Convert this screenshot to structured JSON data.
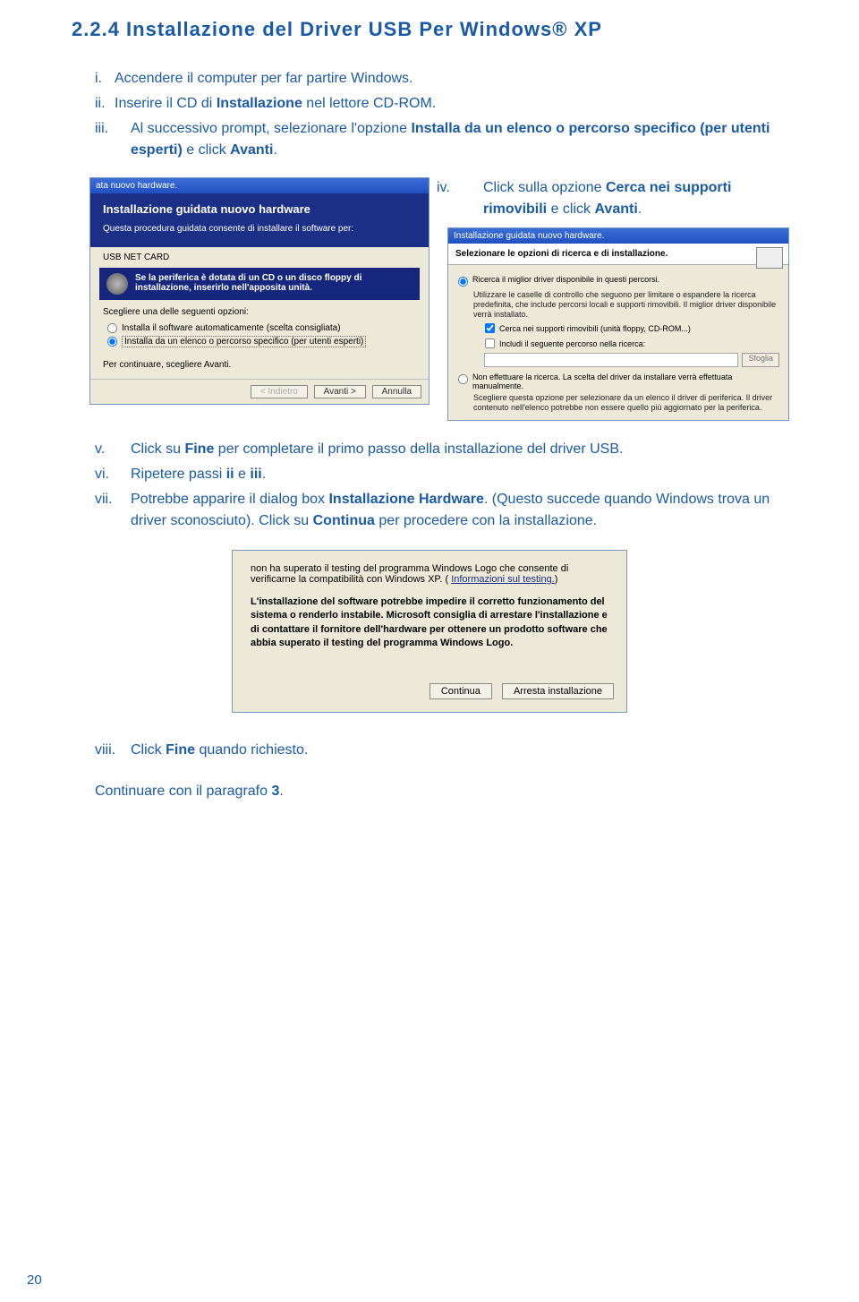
{
  "heading": "2.2.4 Installazione del Driver USB  Per Windows® XP",
  "steps": {
    "i": {
      "n": "i.",
      "text": "Accendere il computer per far partire Windows."
    },
    "ii": {
      "n": "ii.",
      "pre": "Inserire il CD di ",
      "b": "Installazione",
      "post": " nel lettore CD-ROM."
    },
    "iii": {
      "n": "iii.",
      "pre": "Al successivo prompt, selezionare l'opzione ",
      "b": "Installa da un elenco o percorso specifico (per utenti esperti)",
      "post": " e click ",
      "b2": "Avanti",
      "post2": "."
    },
    "iv": {
      "n": "iv.",
      "pre": "Click sulla opzione ",
      "b": "Cerca nei supporti rimovibili",
      "post": " e click ",
      "b2": "Avanti",
      "post2": "."
    },
    "v": {
      "n": "v.",
      "pre": "Click su ",
      "b": "Fine",
      "post": " per completare il primo passo della installazione del driver USB."
    },
    "vi": {
      "n": "vi.",
      "pre": "Ripetere passi ",
      "b": "ii",
      "mid": " e ",
      "b2": "iii",
      "post": "."
    },
    "vii": {
      "n": "vii.",
      "pre": "Potrebbe apparire il dialog box ",
      "b": "Installazione Hardware",
      "post": ". (Questo succede quando Windows trova un driver sconosciuto). Click su ",
      "b2": "Continua",
      "post2": " per procedere con la installazione."
    },
    "viii": {
      "n": "viii.",
      "pre": "Click ",
      "b": "Fine",
      "post": " quando richiesto."
    }
  },
  "closing": {
    "pre": "Continuare con il paragrafo ",
    "b": "3",
    "post": "."
  },
  "pagenum": "20",
  "scr1": {
    "title": "ata nuovo hardware.",
    "wizTitle": "Installazione guidata nuovo hardware",
    "wizDesc": "Questa procedura guidata consente di installare il software per:",
    "device": "USB NET CARD",
    "cd": "Se la periferica è dotata di un CD o un disco floppy di installazione, inserirlo nell'apposita unità.",
    "choose": "Scegliere una delle seguenti opzioni:",
    "opt1": "Installa il software automaticamente (scelta consigliata)",
    "opt2": "Installa da un elenco o percorso specifico (per utenti esperti)",
    "cont": "Per continuare, scegliere Avanti.",
    "back": "< Indietro",
    "next": "Avanti >",
    "cancel": "Annulla"
  },
  "scr2": {
    "title": "Installazione guidata nuovo hardware.",
    "header": "Selezionare le opzioni di ricerca e di installazione.",
    "r1": "Ricerca il miglior driver disponibile in questi percorsi.",
    "r1sub": "Utilizzare le caselle di controllo che seguono per limitare o espandere la ricerca predefinita, che include percorsi locali e supporti rimovibili. Il miglior driver disponibile verrà installato.",
    "c1": "Cerca nei supporti rimovibili (unità floppy, CD-ROM...)",
    "c2": "Includi il seguente percorso nella ricerca:",
    "browse": "Sfoglia",
    "r2": "Non effettuare la ricerca. La scelta del driver da installare verrà effettuata manualmente.",
    "r2sub": "Scegliere questa opzione per selezionare da un elenco il driver di periferica. Il driver contenuto nell'elenco potrebbe non essere quello più aggiornato per la periferica."
  },
  "scr3": {
    "p1a": "non ha superato il testing del programma Windows Logo che consente di verificarne la compatibilità con Windows XP. (",
    "p1link": "Informazioni sul testing.",
    "p1b": ")",
    "bold": "L'installazione del software potrebbe impedire il corretto funzionamento del sistema o renderlo instabile. Microsoft consiglia di arrestare l'installazione e di contattare il fornitore dell'hardware per ottenere un prodotto software che abbia superato il testing del programma Windows Logo.",
    "btnCont": "Continua",
    "btnStop": "Arresta installazione"
  }
}
